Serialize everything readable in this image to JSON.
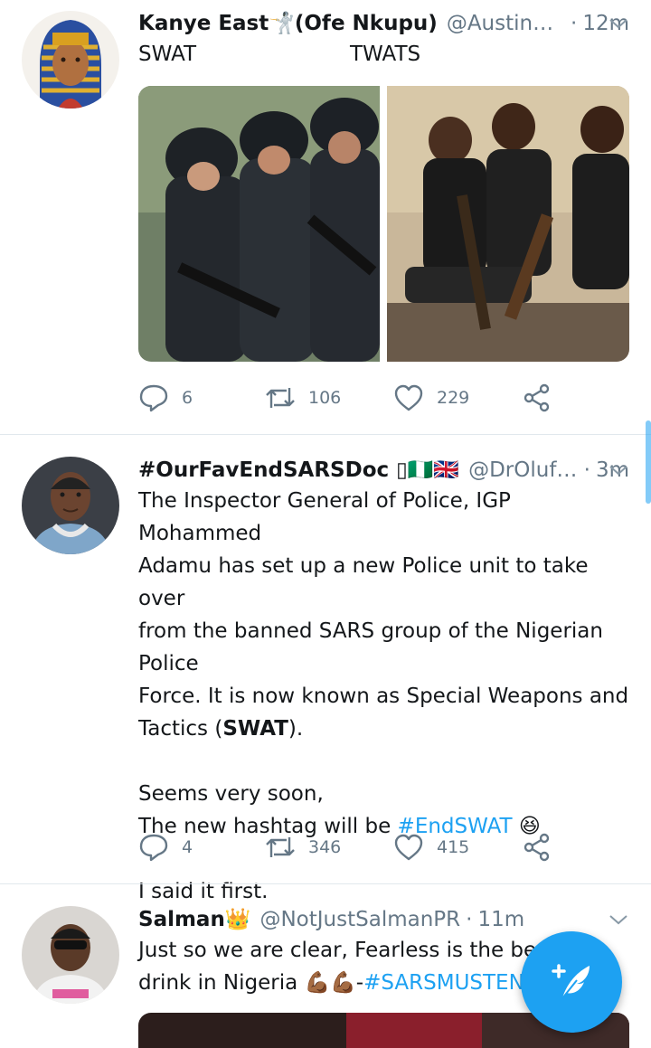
{
  "tweets": [
    {
      "name": "Kanye East🤺(Ofe Nkupu)",
      "handle": "@AustinAna...",
      "time": "12m",
      "caption_left": "SWAT",
      "caption_right": "TWATS",
      "replies": "6",
      "retweets": "106",
      "likes": "229"
    },
    {
      "name": "#OurFavEndSARSDoc ▯🇳🇬🇬🇧",
      "handle": "@DrOlufun...",
      "time": "3m",
      "lines": [
        "The Inspector General of Police, IGP Mohammed",
        "Adamu has set up a new Police unit to take over",
        "from the banned SARS group of the Nigerian Police",
        "Force. It is now known as Special Weapons and",
        "Tactics (",
        "SWAT",
        ")."
      ],
      "line2_a": "Seems very soon,",
      "line2_b": "The new hashtag will be ",
      "hashtag": "#EndSWAT",
      "emoji": "😆",
      "line3": "I said it first.",
      "replies": "4",
      "retweets": "346",
      "likes": "415"
    },
    {
      "name": "Salman👑",
      "handle": "@NotJustSalmanPR",
      "time": "11m",
      "line1": "Just so we are clear, Fearless is the best e",
      "line2_a": "drink in Nigeria 💪🏾💪🏾-",
      "hashtag": "#SARSMUSTENDN"
    }
  ],
  "dot": "·",
  "colors": {
    "accent": "#1da1f2",
    "muted": "#657786",
    "text": "#14171a"
  },
  "icons": [
    "reply-icon",
    "retweet-icon",
    "like-icon",
    "share-icon",
    "chevron-down-icon",
    "compose-tweet-icon"
  ]
}
